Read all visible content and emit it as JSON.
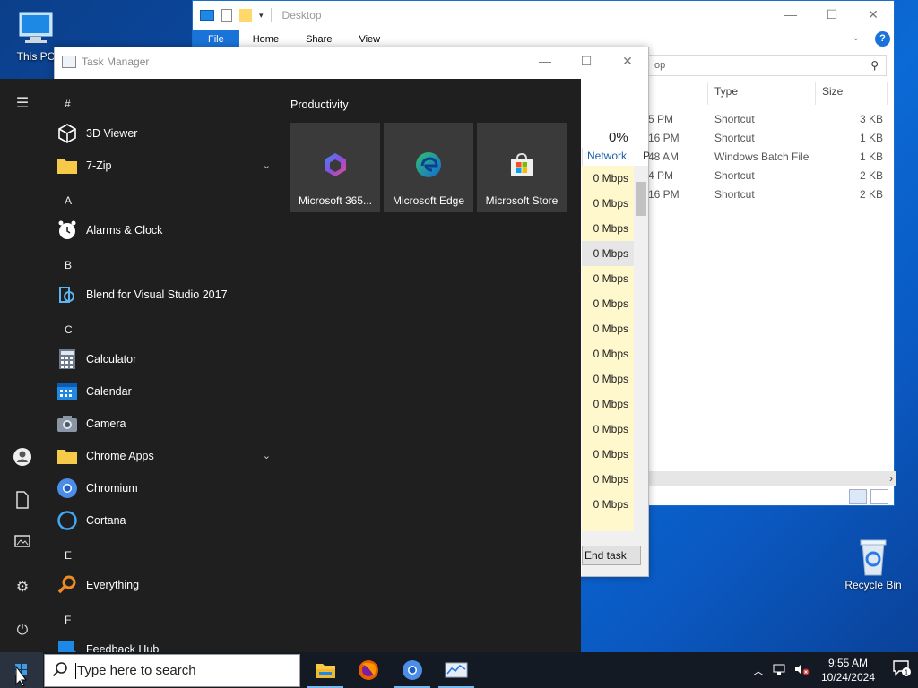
{
  "desktop": {
    "icons": [
      {
        "label": "This PC",
        "icon": "monitor-icon"
      },
      {
        "label": "Recycle Bin",
        "icon": "recycle-bin-icon"
      }
    ]
  },
  "explorer": {
    "title": "Desktop",
    "ribbon_tabs": [
      "File",
      "Home",
      "Share",
      "View"
    ],
    "search_placeholder": "op",
    "columns": [
      "Type",
      "Size"
    ],
    "rows": [
      {
        "time": "5 PM",
        "type": "Shortcut",
        "size": "3 KB"
      },
      {
        "time": "16 PM",
        "type": "Shortcut",
        "size": "1 KB"
      },
      {
        "time": "48 AM",
        "type": "Windows Batch File",
        "size": "1 KB"
      },
      {
        "time": "4 PM",
        "type": "Shortcut",
        "size": "2 KB"
      },
      {
        "time": "16 PM",
        "type": "Shortcut",
        "size": "2 KB"
      }
    ]
  },
  "task_manager": {
    "title": "Task Manager",
    "network_percent": "0%",
    "network_header": "Network",
    "p_header": "P",
    "network_values": [
      "0 Mbps",
      "0 Mbps",
      "0 Mbps",
      "0 Mbps",
      "0 Mbps",
      "0 Mbps",
      "0 Mbps",
      "0 Mbps",
      "0 Mbps",
      "0 Mbps",
      "0 Mbps",
      "0 Mbps",
      "0 Mbps",
      "0 Mbps"
    ],
    "end_task_label": "End task"
  },
  "start_menu": {
    "group_title": "Productivity",
    "tiles": [
      {
        "label": "Microsoft 365...",
        "icon": "microsoft-365-icon"
      },
      {
        "label": "Microsoft Edge",
        "icon": "edge-icon"
      },
      {
        "label": "Microsoft Store",
        "icon": "store-icon"
      }
    ],
    "sections": [
      {
        "letter": "#",
        "apps": [
          {
            "label": "3D Viewer",
            "icon": "cube-icon"
          },
          {
            "label": "7-Zip",
            "icon": "folder-icon",
            "expandable": true
          }
        ]
      },
      {
        "letter": "A",
        "apps": [
          {
            "label": "Alarms & Clock",
            "icon": "clock-icon"
          }
        ]
      },
      {
        "letter": "B",
        "apps": [
          {
            "label": "Blend for Visual Studio 2017",
            "icon": "blend-icon"
          }
        ]
      },
      {
        "letter": "C",
        "apps": [
          {
            "label": "Calculator",
            "icon": "calculator-icon"
          },
          {
            "label": "Calendar",
            "icon": "calendar-icon"
          },
          {
            "label": "Camera",
            "icon": "camera-icon"
          },
          {
            "label": "Chrome Apps",
            "icon": "folder-icon",
            "expandable": true
          },
          {
            "label": "Chromium",
            "icon": "chromium-icon"
          },
          {
            "label": "Cortana",
            "icon": "cortana-icon"
          }
        ]
      },
      {
        "letter": "E",
        "apps": [
          {
            "label": "Everything",
            "icon": "search-magnifier-icon"
          }
        ]
      },
      {
        "letter": "F",
        "apps": [
          {
            "label": "Feedback Hub",
            "icon": "feedback-icon"
          }
        ]
      }
    ]
  },
  "taskbar": {
    "search_placeholder": "Type here to search",
    "time": "9:55 AM",
    "date": "10/24/2024",
    "notification_count": "1"
  }
}
